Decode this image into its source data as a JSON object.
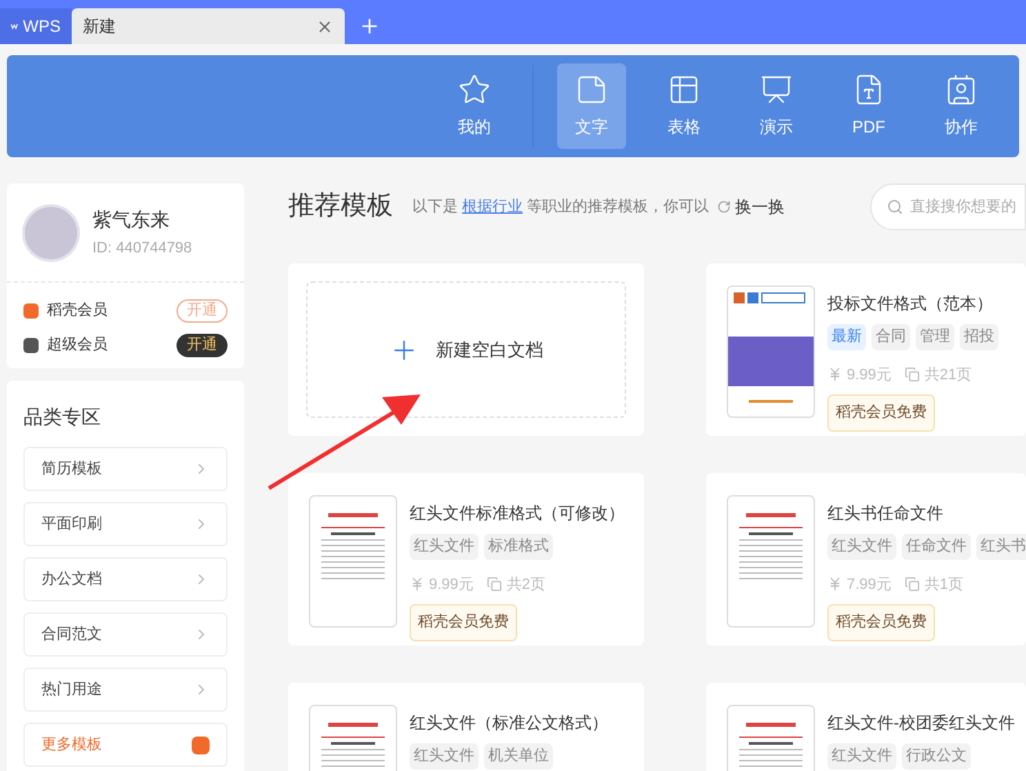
{
  "tabs": [
    {
      "label": "WPS",
      "kind": "logo",
      "selected": false
    },
    {
      "label": "新建",
      "kind": "doc",
      "selected": true
    }
  ],
  "nav": [
    {
      "label": "我的",
      "kind": "mine",
      "selected": false
    },
    {
      "label": "文字",
      "kind": "writer",
      "selected": true
    },
    {
      "label": "表格",
      "kind": "sheet",
      "selected": false
    },
    {
      "label": "演示",
      "kind": "slides",
      "selected": false
    },
    {
      "label": "PDF",
      "kind": "pdf",
      "selected": false
    },
    {
      "label": "协作",
      "kind": "team",
      "selected": false
    }
  ],
  "profile": {
    "name": "紫气东来",
    "id": "ID: 440744798"
  },
  "memberships": [
    {
      "label": "稻壳会员",
      "button": "开通",
      "kind": "daoke"
    },
    {
      "label": "超级会员",
      "button": "开通",
      "kind": "super"
    }
  ],
  "categories": {
    "title": "品类专区",
    "items": [
      {
        "label": "简历模板",
        "kind": "normal"
      },
      {
        "label": "平面印刷",
        "kind": "normal"
      },
      {
        "label": "办公文档",
        "kind": "normal"
      },
      {
        "label": "合同范文",
        "kind": "normal"
      },
      {
        "label": "热门用途",
        "kind": "normal"
      },
      {
        "label": "更多模板",
        "kind": "more"
      }
    ]
  },
  "recommend": {
    "title": "推荐模板",
    "intro_before": "以下是",
    "link": "根据行业",
    "intro_after": "等职业的推荐模板，你可以",
    "refresh": "换一换",
    "search_placeholder": "直接搜你想要的"
  },
  "new_blank": {
    "label": "新建空白文档"
  },
  "templates": [
    {
      "title": "投标文件格式（范本）",
      "kind": "cover",
      "tags": [
        {
          "label": "最新",
          "kind": "new"
        },
        {
          "label": "合同",
          "kind": "normal"
        },
        {
          "label": "管理",
          "kind": "normal"
        },
        {
          "label": "招投",
          "kind": "normal"
        }
      ],
      "price": "9.99元",
      "pages": "共21页",
      "badge": "稻壳会员免费"
    },
    {
      "title": "红头文件标准格式（可修改）",
      "kind": "letterhead",
      "tags": [
        {
          "label": "红头文件",
          "kind": "normal"
        },
        {
          "label": "标准格式",
          "kind": "normal"
        }
      ],
      "price": "9.99元",
      "pages": "共2页",
      "badge": "稻壳会员免费"
    },
    {
      "title": "红头书任命文件",
      "kind": "letterhead",
      "tags": [
        {
          "label": "红头文件",
          "kind": "normal"
        },
        {
          "label": "任命文件",
          "kind": "normal"
        },
        {
          "label": "红头书",
          "kind": "normal"
        }
      ],
      "price": "7.99元",
      "pages": "共1页",
      "badge": "稻壳会员免费"
    },
    {
      "title": "红头文件（标准公文格式）",
      "kind": "letterhead",
      "tags": [
        {
          "label": "红头文件",
          "kind": "normal"
        },
        {
          "label": "机关单位",
          "kind": "normal"
        }
      ]
    },
    {
      "title": "红头文件-校团委红头文件",
      "kind": "letterhead",
      "tags": [
        {
          "label": "红头文件",
          "kind": "normal"
        },
        {
          "label": "行政公文",
          "kind": "normal"
        }
      ]
    }
  ]
}
